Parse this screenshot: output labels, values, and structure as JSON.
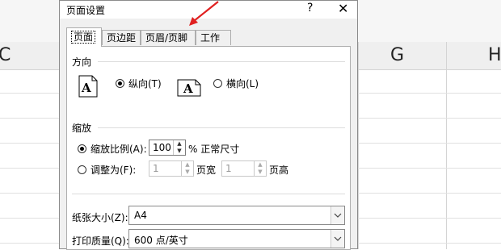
{
  "sheet": {
    "columns": [
      "C",
      "G",
      "H"
    ]
  },
  "dialog": {
    "title": "页面设置",
    "help_icon": "?",
    "close_icon": "✕",
    "tabs": [
      {
        "label": "页面",
        "active": true
      },
      {
        "label": "页边距",
        "active": false
      },
      {
        "label": "页眉/页脚",
        "active": false
      },
      {
        "label": "工作表",
        "active": false
      }
    ],
    "orientation": {
      "heading": "方向",
      "portrait_label": "纵向(T)",
      "landscape_label": "横向(L)",
      "portrait_selected": true
    },
    "scaling": {
      "heading": "缩放",
      "adjust_label": "缩放比例(A):",
      "adjust_value": "100",
      "adjust_suffix": "% 正常尺寸",
      "fit_label": "调整为(F):",
      "fit_wide_value": "1",
      "fit_wide_suffix": "页宽",
      "fit_tall_value": "1",
      "fit_tall_suffix": "页高"
    },
    "paper_size": {
      "label": "纸张大小(Z):",
      "value": "A4"
    },
    "print_quality": {
      "label": "打印质量(Q):",
      "value": "600 点/英寸"
    }
  },
  "annotation": {
    "color": "#e02020"
  }
}
